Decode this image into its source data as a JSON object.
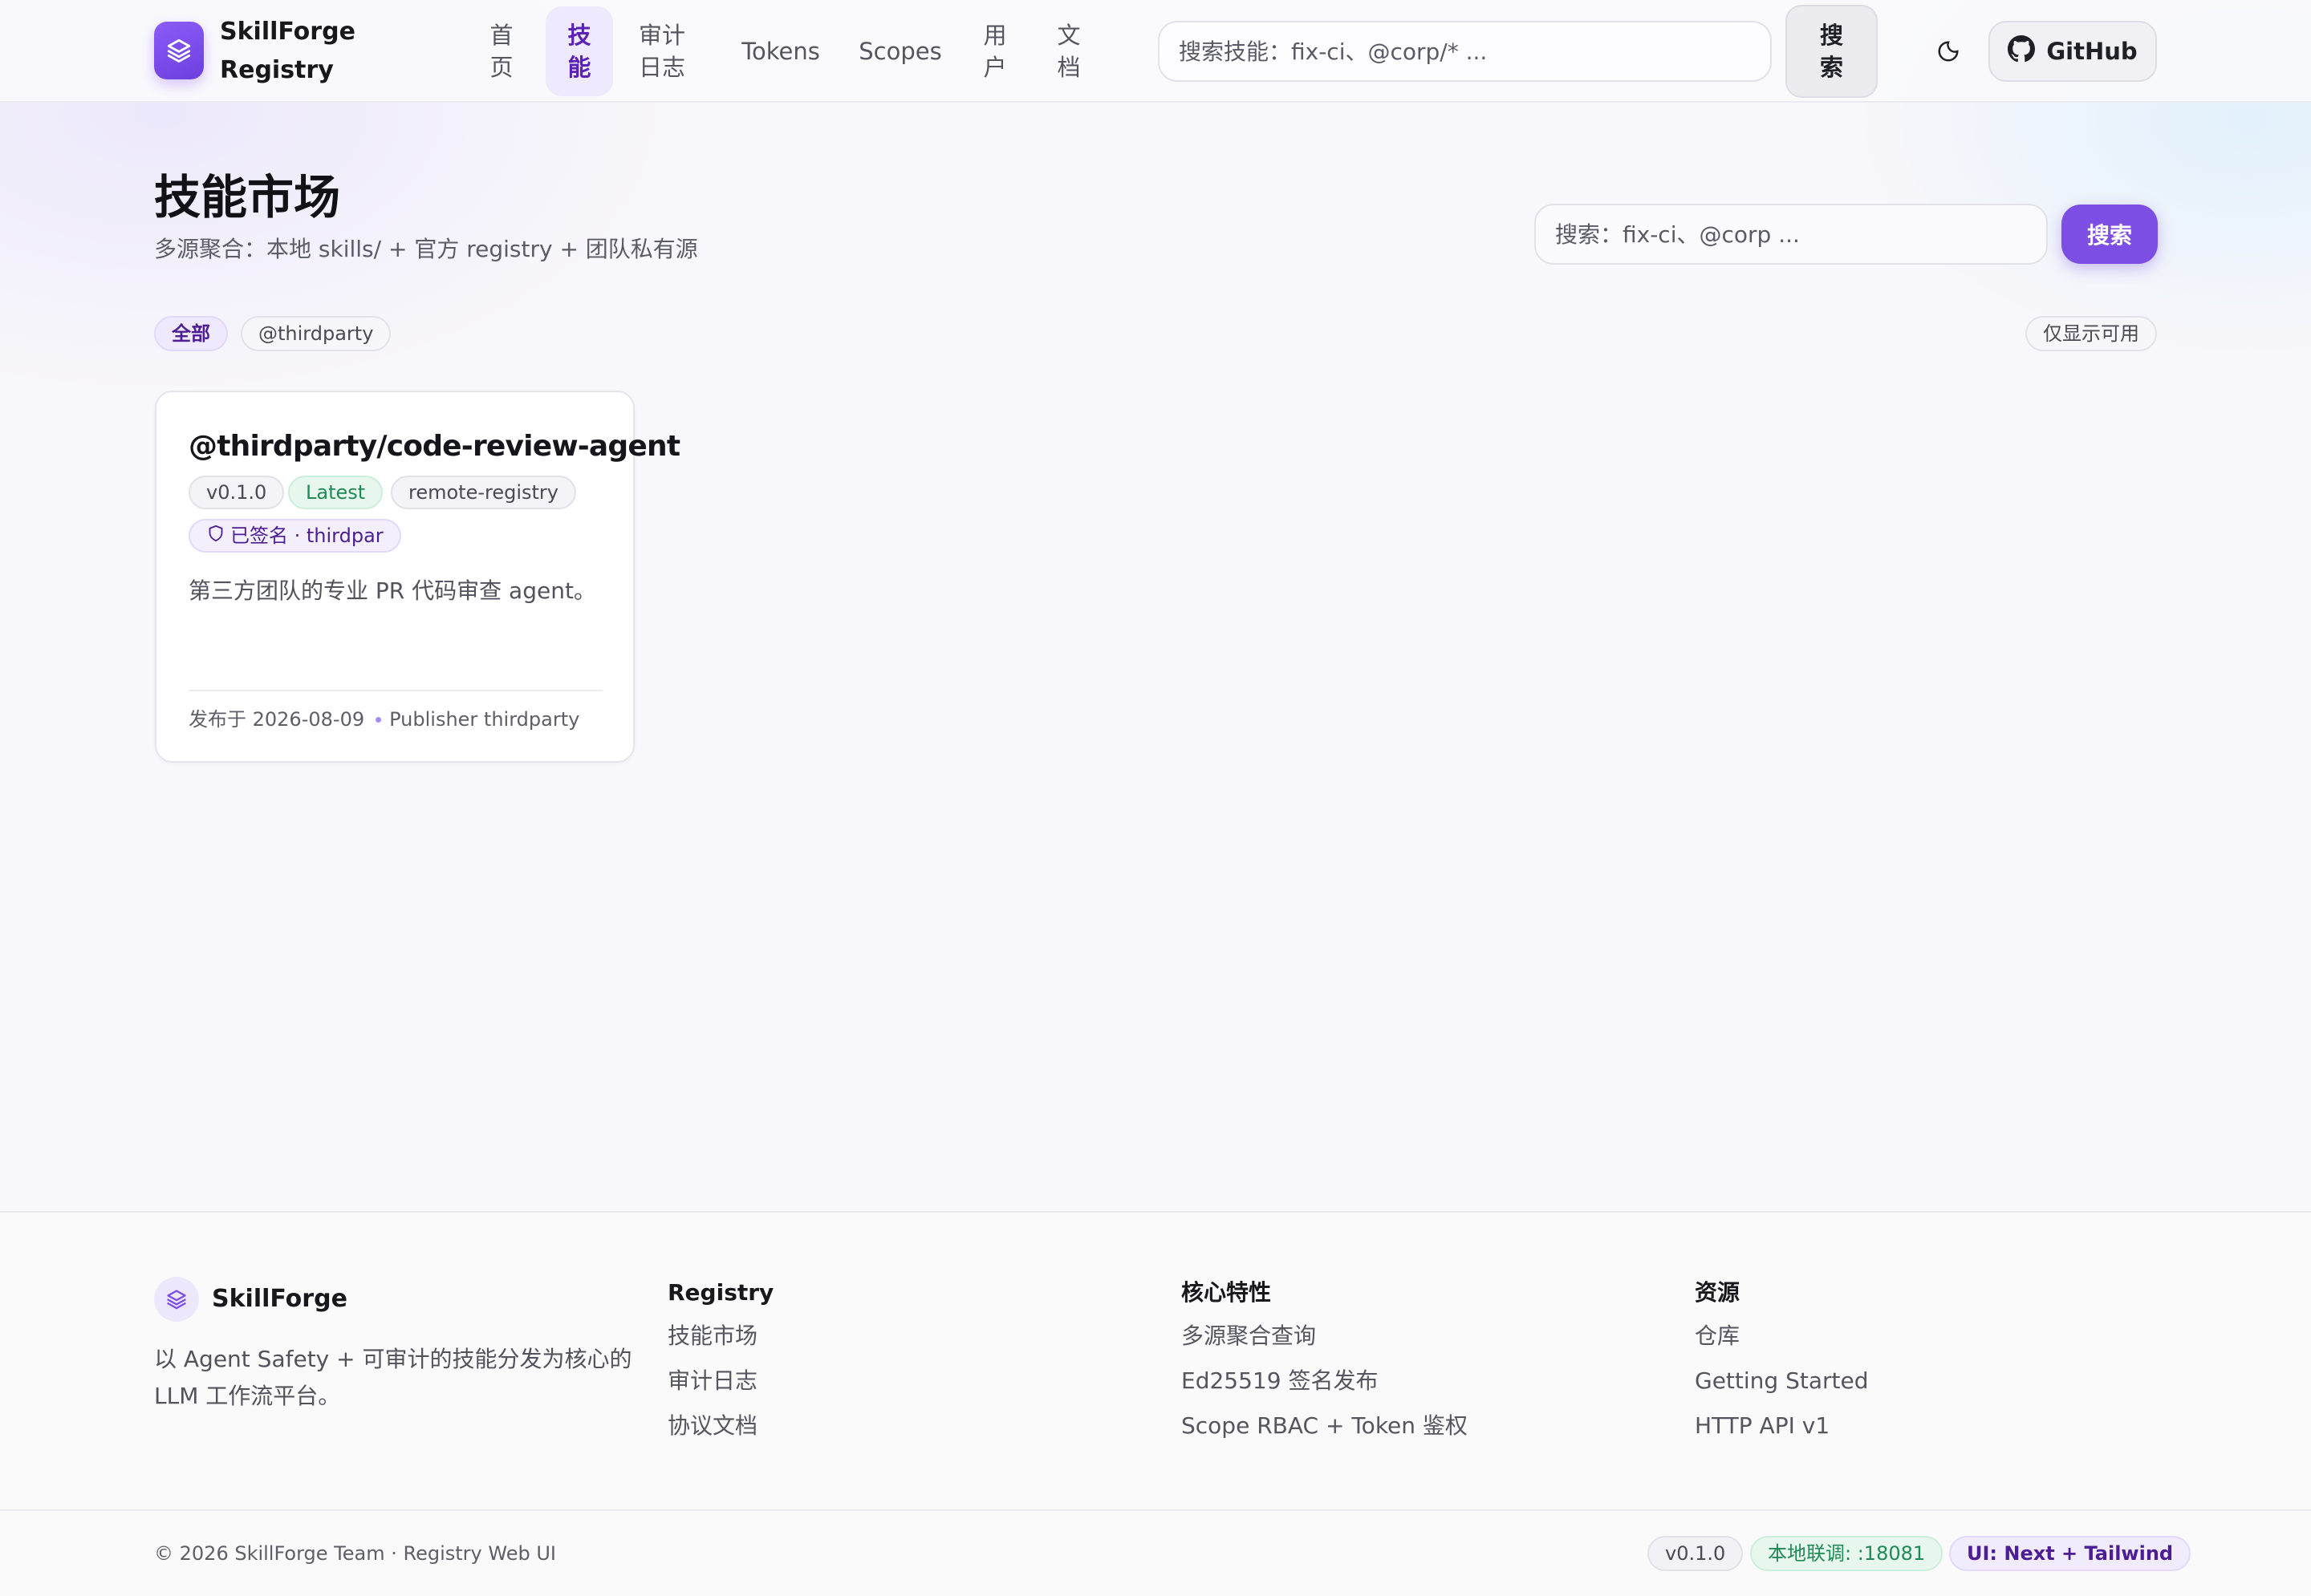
{
  "header": {
    "brand_line1": "SkillForge",
    "brand_line2": "Registry",
    "nav": [
      {
        "label": "首页",
        "active": false
      },
      {
        "label": "技能",
        "active": true
      },
      {
        "label": "审计日志",
        "active": false
      },
      {
        "label": "Tokens",
        "active": false
      },
      {
        "label": "Scopes",
        "active": false
      },
      {
        "label": "用户",
        "active": false
      },
      {
        "label": "文档",
        "active": false
      }
    ],
    "search_placeholder": "搜索技能：fix-ci、@corp/* ...",
    "search_button": "搜索",
    "theme_icon": "moon-icon",
    "github_label": "GitHub"
  },
  "page": {
    "title": "技能市场",
    "subtitle": "多源聚合：本地 skills/ + 官方 registry + 团队私有源",
    "search_placeholder": "搜索：fix-ci、@corp ...",
    "search_button": "搜索"
  },
  "filters": {
    "scopes": [
      {
        "label": "全部",
        "active": true
      },
      {
        "label": "@thirdparty",
        "active": false
      }
    ],
    "available_only": "仅显示可用"
  },
  "skills": [
    {
      "name": "@thirdparty/code-review-agent",
      "version": "v0.1.0",
      "latest": "Latest",
      "source": "remote-registry",
      "signature": "已签名 · thirdpar",
      "description": "第三方团队的专业 PR 代码审查 agent。",
      "published": "发布于 2026-08-09",
      "publisher": "Publisher thirdparty"
    }
  ],
  "footer": {
    "brand": "SkillForge",
    "about": "以 Agent Safety + 可审计的技能分发为核心的 LLM 工作流平台。",
    "columns": [
      {
        "title": "Registry",
        "links": [
          "技能市场",
          "审计日志",
          "协议文档"
        ]
      },
      {
        "title": "核心特性",
        "links": [
          "多源聚合查询",
          "Ed25519 签名发布",
          "Scope RBAC + Token 鉴权"
        ]
      },
      {
        "title": "资源",
        "links": [
          "仓库",
          "Getting Started",
          "HTTP API v1"
        ]
      }
    ],
    "copyright": "© 2026 SkillForge Team · Registry Web UI",
    "badges": {
      "version": "v0.1.0",
      "local": "本地联调: :18081",
      "ui": "UI: Next + Tailwind"
    }
  },
  "colors": {
    "accent": "#7c4ee4",
    "accent_soft": "#efe9fd",
    "success": "#1f8a55"
  }
}
